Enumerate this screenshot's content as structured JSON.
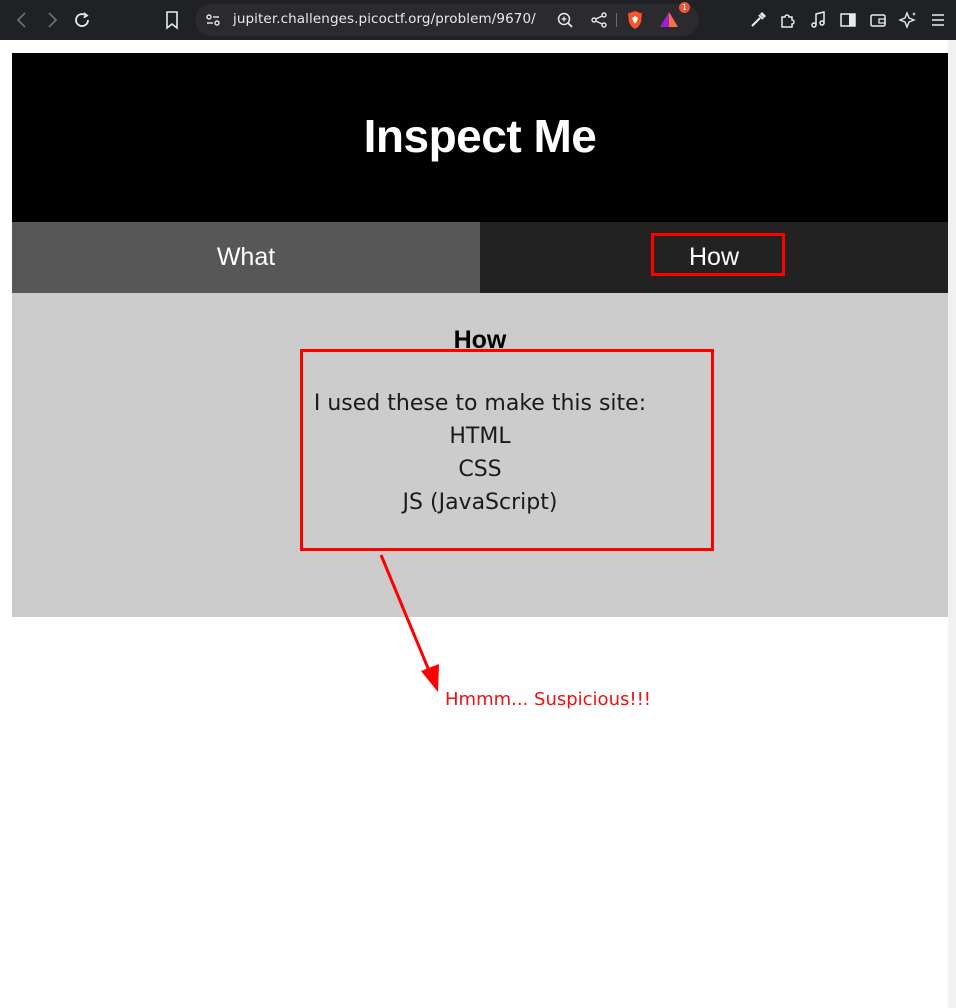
{
  "browser": {
    "url": "jupiter.challenges.picoctf.org/problem/9670/",
    "notification_count": "1"
  },
  "page": {
    "title": "Inspect Me",
    "tabs": [
      {
        "label": "What",
        "active": false
      },
      {
        "label": "How",
        "active": true
      }
    ],
    "content": {
      "heading": "How",
      "lines": [
        "I used these to make this site:",
        "HTML",
        "CSS",
        "JS (JavaScript)"
      ]
    }
  },
  "annotation": {
    "note": "Hmmm... Suspicious!!!",
    "color": "#ff0000"
  }
}
